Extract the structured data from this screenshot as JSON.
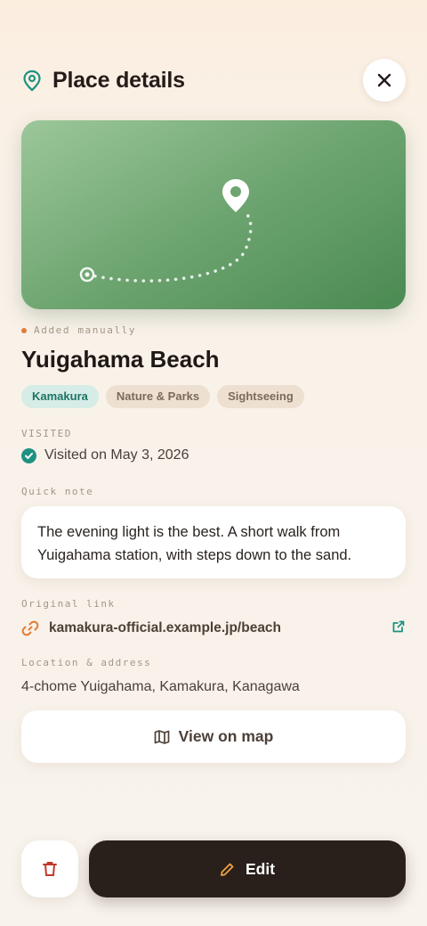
{
  "header": {
    "title": "Place details"
  },
  "place": {
    "source": "Added manually",
    "name": "Yuigahama Beach",
    "tags": [
      "Kamakura",
      "Nature & Parks",
      "Sightseeing"
    ]
  },
  "visited": {
    "label": "VISITED",
    "text": "Visited on May 3, 2026"
  },
  "note": {
    "label": "Quick note",
    "text": "The evening light is the best. A short walk from Yuigahama station, with steps down to the sand."
  },
  "link": {
    "label": "Original link",
    "url": "kamakura-official.example.jp/beach"
  },
  "location": {
    "label": "Location & address",
    "address": "4-chome Yuigahama, Kamakura, Kanagawa"
  },
  "actions": {
    "view_map": "View on map",
    "edit": "Edit"
  },
  "icons": {
    "header": "map-pin-icon",
    "close": "close-icon",
    "hero_pin": "map-pin-icon",
    "visited": "check-circle-icon",
    "link": "link-icon",
    "external": "external-link-icon",
    "map": "map-icon",
    "delete": "trash-icon",
    "edit": "pencil-icon"
  },
  "colors": {
    "accent": "#1e9282",
    "orange": "#e57b35",
    "dark": "#2a201b",
    "delete": "#c0392b"
  }
}
